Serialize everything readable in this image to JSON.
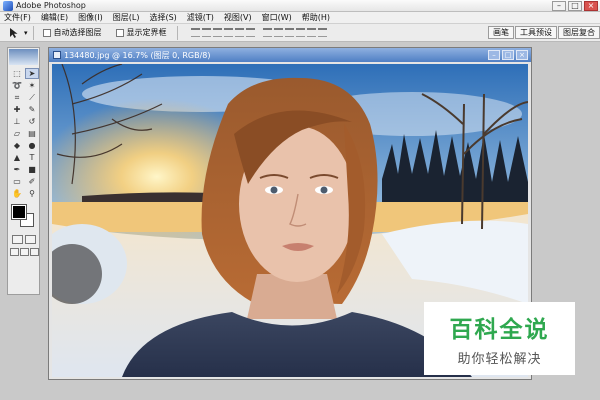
{
  "window": {
    "title": "Adobe Photoshop"
  },
  "menu": [
    "文件(F)",
    "编辑(E)",
    "图像(I)",
    "图层(L)",
    "选择(S)",
    "滤镜(T)",
    "视图(V)",
    "窗口(W)",
    "帮助(H)"
  ],
  "options": {
    "auto_select_label": "自动选择图层",
    "show_bounds_label": "显示定界框"
  },
  "panels": [
    "画笔",
    "工具预设",
    "图层复合"
  ],
  "document": {
    "title": "134480.jpg @ 16.7% (图层 0, RGB/8)"
  },
  "watermark": {
    "title": "百科全说",
    "subtitle": "助你轻松解决"
  },
  "icons": [
    "move-icon",
    "marquee-icon",
    "lasso-icon",
    "magic-wand-icon",
    "crop-icon",
    "slice-icon",
    "healing-icon",
    "brush-icon",
    "stamp-icon",
    "history-brush-icon",
    "eraser-icon",
    "gradient-icon",
    "blur-icon",
    "dodge-icon",
    "path-select-icon",
    "type-icon",
    "pen-icon",
    "shape-icon",
    "notes-icon",
    "eyedropper-icon",
    "hand-icon",
    "zoom-icon"
  ]
}
